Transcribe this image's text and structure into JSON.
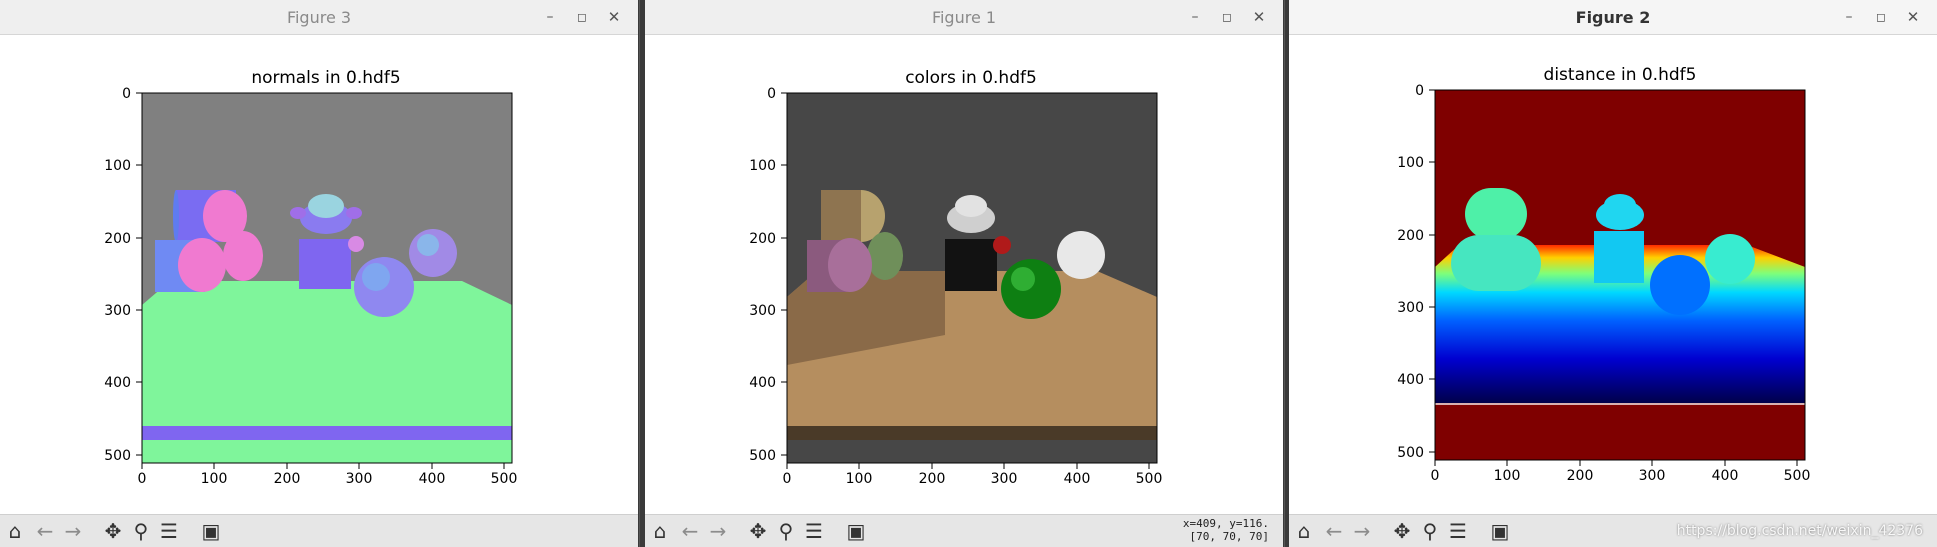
{
  "windows": [
    {
      "title": "Figure 3",
      "plot_title": "normals in 0.hdf5",
      "image_kind": "normals",
      "controls": {
        "minimize": "–",
        "maximize": "◻",
        "close": "✕"
      }
    },
    {
      "title": "Figure 1",
      "plot_title": "colors in 0.hdf5",
      "image_kind": "colors",
      "controls": {
        "minimize": "–",
        "maximize": "◻",
        "close": "✕"
      },
      "coord_readout_line1": "x=409, y=116.",
      "coord_readout_line2": "[70, 70, 70]"
    },
    {
      "title": "Figure 2",
      "plot_title": "distance in 0.hdf5",
      "image_kind": "distance",
      "controls": {
        "minimize": "–",
        "maximize": "◻",
        "close": "✕"
      },
      "watermark": "https://blog.csdn.net/weixin_42376"
    }
  ],
  "axes": {
    "x_ticks": [
      "0",
      "100",
      "200",
      "300",
      "400",
      "500"
    ],
    "y_ticks": [
      "0",
      "100",
      "200",
      "300",
      "400",
      "500"
    ],
    "range": [
      0,
      511
    ]
  },
  "toolbar": {
    "icons": [
      "home-icon",
      "back-arrow-icon",
      "forward-arrow-icon",
      "pan-icon",
      "zoom-icon",
      "configure-subplots-icon",
      "save-icon"
    ]
  },
  "colors": {
    "normals_background": "#808080",
    "normals_floor": "#7ff59b",
    "normals_strip": "#7f66f0",
    "colors_background": "#474747",
    "colors_floor": "#b58e5f",
    "colors_edge": "#4a3a28",
    "distance_background": "#7f0000"
  }
}
